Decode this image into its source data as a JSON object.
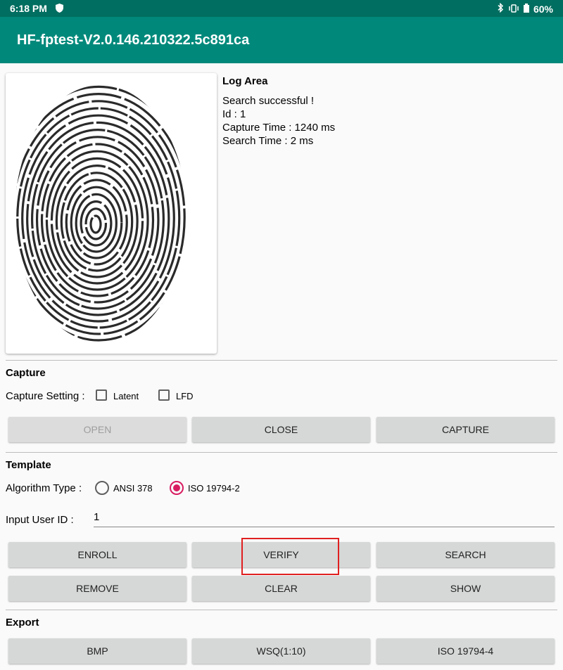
{
  "status_bar": {
    "time": "6:18 PM",
    "battery": "60%",
    "icons": [
      "shield-icon",
      "bluetooth-icon",
      "vibrate-icon",
      "battery-icon"
    ]
  },
  "app": {
    "title": "HF-fptest-V2.0.146.210322.5c891ca"
  },
  "log": {
    "title": "Log Area",
    "lines": [
      "Search successful !",
      "Id : 1",
      "Capture Time : 1240 ms",
      "Search Time : 2 ms"
    ]
  },
  "capture": {
    "title": "Capture",
    "setting_label": "Capture Setting :",
    "latent_label": "Latent",
    "lfd_label": "LFD",
    "open": "OPEN",
    "close": "CLOSE",
    "capture": "CAPTURE"
  },
  "template": {
    "title": "Template",
    "algorithm_label": "Algorithm Type :",
    "ansi_label": "ANSI 378",
    "iso_label": "ISO 19794-2",
    "selected_algorithm": "ISO 19794-2",
    "user_id_label": "Input User ID :",
    "user_id_value": "1",
    "enroll": "ENROLL",
    "verify": "VERIFY",
    "search": "SEARCH",
    "remove": "REMOVE",
    "clear": "CLEAR",
    "show": "SHOW"
  },
  "export": {
    "title": "Export",
    "bmp": "BMP",
    "wsq": "WSQ(1:10)",
    "iso": "ISO 19794-4"
  },
  "colors": {
    "status_bar": "#006e60",
    "app_bar": "#00897b",
    "radio_accent": "#d81b60",
    "highlight": "#e02020"
  }
}
